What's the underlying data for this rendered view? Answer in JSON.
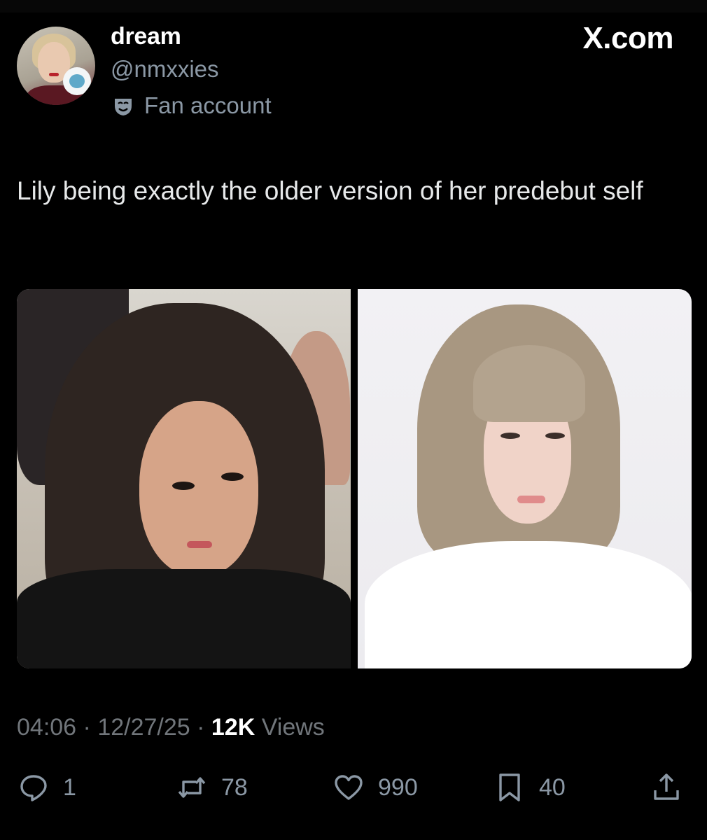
{
  "site": {
    "mark": "X.com"
  },
  "author": {
    "display_name": "dream",
    "handle": "@nmxxies",
    "account_label": "Fan account",
    "label_icon": "theater-mask-icon"
  },
  "tweet": {
    "text": "Lily being exactly the older version of her predebut self",
    "media": [
      {
        "name": "photo-predebut",
        "icon": "photo"
      },
      {
        "name": "photo-current",
        "icon": "photo"
      }
    ]
  },
  "meta": {
    "time": "04:06",
    "separator": " · ",
    "date": "12/27/25",
    "views_count": "12K",
    "views_label": " Views"
  },
  "actions": {
    "replies": "1",
    "reposts": "78",
    "likes": "990",
    "bookmarks": "40"
  },
  "colors": {
    "background": "#000000",
    "primary_text": "#e7e9ea",
    "secondary_text": "#8b98a5",
    "meta_text": "#71767b"
  }
}
